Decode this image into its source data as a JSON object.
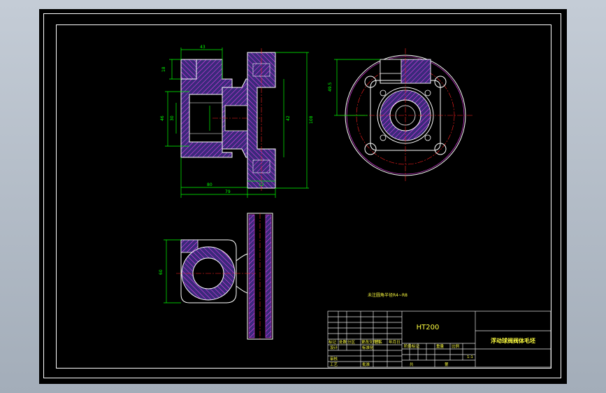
{
  "colors": {
    "background": "#000000",
    "frame": "#ffffff",
    "outline": "#ffffff",
    "hatch": "#ff40ff",
    "section_fill": "#3a2a7a",
    "dimension": "#00ff00",
    "centerline": "#ff2020",
    "titleblock": "#e6e6e6",
    "titleblock_text": "#ffff40"
  },
  "note_text": "未注圆角半径R4~R8",
  "title_block": {
    "material": "HT200",
    "drawing_name": "浮动球阀阀体毛坯",
    "scale": "1:1",
    "labels": {
      "mark": "标记",
      "design": "设计",
      "standard": "标准化",
      "review": "审核",
      "process": "工艺",
      "approve": "批准",
      "stage": "阶段标记",
      "weight": "重量",
      "scale_label": "比例",
      "sheets": "共",
      "sheet": "第",
      "count": "处数",
      "zone": "分区",
      "change_doc": "更改文件号",
      "sign": "签名",
      "date": "年月日"
    }
  },
  "dimensions": {
    "front_top_width": "43",
    "front_left_top": "18",
    "front_left_mid": "46",
    "front_left_inner": "30",
    "front_right_inner": "42",
    "front_right_height": "108",
    "front_bottom_left": "80",
    "front_bottom_right": "12",
    "front_total_width": "79",
    "side_height": "49.5",
    "bottom_height": "60"
  }
}
